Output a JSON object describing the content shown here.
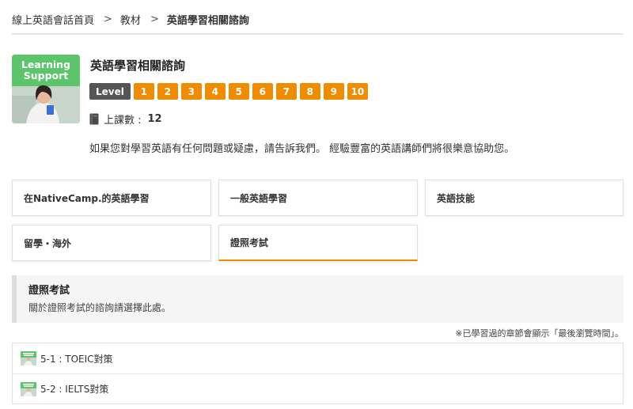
{
  "breadcrumb": {
    "home": "線上英語會話首頁",
    "separator": ">",
    "materials": "教材",
    "current": "英語學習相關諮詢"
  },
  "course": {
    "thumbnail_text": [
      "Learning",
      "Support"
    ],
    "title": "英語學習相關諮詢",
    "level_label": "Level",
    "levels": [
      "1",
      "2",
      "3",
      "4",
      "5",
      "6",
      "7",
      "8",
      "9",
      "10"
    ],
    "lessons_label": "上課數 :",
    "lessons_count": "12",
    "description": "如果您對學習英語有任何問題或疑慮，請告訴我們。 經驗豐富的英語講師們將很樂意協助您。"
  },
  "categories": [
    {
      "label": "在NativeCamp.的英語學習",
      "active": false
    },
    {
      "label": "一般英語學習",
      "active": false
    },
    {
      "label": "英語技能",
      "active": false
    },
    {
      "label": "留學・海外",
      "active": false
    },
    {
      "label": "證照考試",
      "active": true
    }
  ],
  "section": {
    "title": "證照考試",
    "subtitle": "關於證照考試的諮詢請選擇此處。"
  },
  "note": "※已學習過的章節會顯示「最後瀏覽時間」。",
  "chapters": [
    {
      "label": "5-1 : TOEIC對策"
    },
    {
      "label": "5-2 : IELTS對策"
    }
  ],
  "colors": {
    "accent": "#f08c00",
    "level_label_bg": "#555555",
    "thumbnail_green": "#5cc46a"
  },
  "icons": {
    "lessons": "book-icon"
  }
}
